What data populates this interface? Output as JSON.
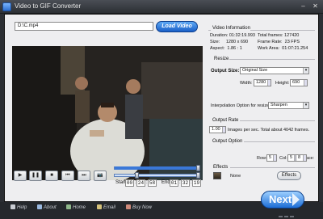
{
  "window": {
    "title": "Video to GIF Converter"
  },
  "file": {
    "path": "D:\\C.mp4",
    "load_label": "Load Video"
  },
  "video_info": {
    "section": "Video Information",
    "duration_label": "Duration:",
    "duration": "01:32:19.993",
    "total_frames_label": "Total frames:",
    "total_frames": "127420",
    "size_label": "Size:",
    "size": "1280 x 690",
    "frame_rate_label": "Frame Rate:",
    "frame_rate": "23 FPS",
    "aspect_label": "Aspect:",
    "aspect": "1.86 : 1",
    "work_area_label": "Work Area:",
    "work_area": "01:07:21.254"
  },
  "resize": {
    "section": "Resize",
    "output_size_label": "Output Size:",
    "output_size": "Original Size",
    "width_label": "Width:",
    "width": "1280",
    "height_label": "Height:",
    "height": "690",
    "interp_label": "Interpolation Option for resize:",
    "interp": "Sharpen"
  },
  "output_rate": {
    "section": "Output Rate",
    "rate": "1.00",
    "rate_text": "Images per sec. Total about 4042 frames."
  },
  "output_option": {
    "section": "Output Option",
    "row_label": "Row:",
    "row": "5",
    "col_label": "Col:",
    "col": "5",
    "space_label": "Space:",
    "space": "8"
  },
  "effects": {
    "section": "Effects",
    "value": "None",
    "button": "Effects"
  },
  "timeline": {
    "start_label": "Start",
    "start": [
      "00",
      "24",
      "58"
    ],
    "end_label": "End",
    "end": [
      "01",
      "32",
      "19"
    ],
    "seek_progress": 0.98,
    "range_start": 0.27,
    "range_end": 0.98
  },
  "controls": {
    "play": "▶",
    "pause": "❚❚",
    "stop": "■",
    "prev": "⏮",
    "next": "⏭",
    "snapshot": "📷"
  },
  "footer": {
    "help": "Help",
    "about": "About",
    "home": "Home",
    "email": "Email",
    "buy": "Buy Now",
    "next": "Next"
  },
  "colors": {
    "accent": "#1a5fc7",
    "frame": "#2b2e33"
  }
}
